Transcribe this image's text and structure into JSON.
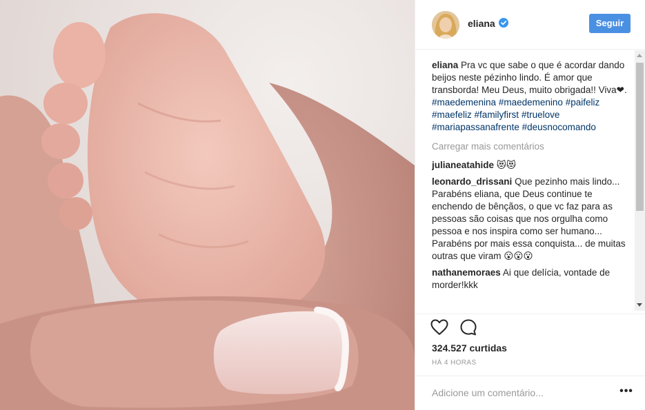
{
  "post": {
    "username": "eliana",
    "follow_label": "Seguir",
    "caption": {
      "username": "eliana",
      "text": "Pra vc que sabe o que é acordar dando beijos neste pézinho lindo. É amor que transborda! Meu Deus, muito obrigada!! Viva",
      "heart": "❤",
      "end": ".",
      "hashtags": [
        "#maedemenina",
        "#maedemenino",
        "#paifeliz",
        "#maefeliz",
        "#familyfirst",
        "#truelove",
        "#mariapassanafrente",
        "#deusnocomando"
      ]
    },
    "load_more_label": "Carregar mais comentários",
    "comments": [
      {
        "username": "julianeatahide",
        "text": "😻😻"
      },
      {
        "username": "leonardo_drissani",
        "text": "Que pezinho mais lindo... Parabéns eliana, que Deus continue te enchendo de bênçãos, o que vc faz para as pessoas são coisas que nos orgulha como pessoa e nos inspira como ser humano... Parabéns por mais essa conquista... de muitas outras que viram 😮😮😮"
      },
      {
        "username": "nathanemoraes",
        "text": "Ai que delícia, vontade de morder!kkk"
      }
    ],
    "likes": "324.527 curtidas",
    "time": "HÁ 4 HORAS",
    "add_comment_placeholder": "Adicione um comentário...",
    "more_label": "•••"
  },
  "icons": {
    "verified": "verified-badge-icon",
    "like": "heart-icon",
    "comment": "comment-icon",
    "more": "more-options-icon"
  },
  "colors": {
    "follow_button": "#4a90e2",
    "hashtag": "#003569",
    "verified": "#3897f0"
  }
}
